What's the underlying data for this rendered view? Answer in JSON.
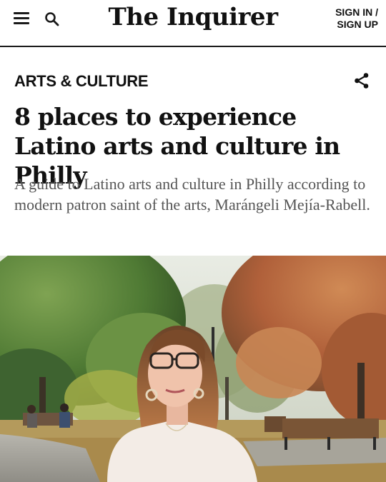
{
  "header": {
    "logo": "The Inquirer",
    "signin_line1": "SIGN IN /",
    "signin_line2": "SIGN UP"
  },
  "icons": {
    "menu": "hamburger-menu-icon",
    "search": "search-icon",
    "share": "share-icon"
  },
  "article": {
    "section": "ARTS & CULTURE",
    "headline": "8 places to experience Latino arts and culture in Philly",
    "dek": "A guide to Latino arts and culture in Philly according to modern patron saint of the arts, Marángeli Mejía-Rabell."
  },
  "colors": {
    "text": "#111111",
    "dek": "#555555"
  }
}
